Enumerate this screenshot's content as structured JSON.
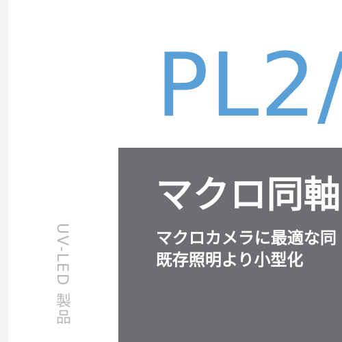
{
  "product": {
    "model": "PL2/",
    "category_vertical": "UV-LED 製品"
  },
  "feature": {
    "heading": "マクロ同軸",
    "desc_line_1": "マクロカメラに最適な同",
    "desc_line_2": "既存照明より小型化"
  },
  "colors": {
    "brand_blue": "#5aa0d6",
    "panel_gray": "#6d6e71",
    "muted_gray": "#b6b8bc",
    "strip": "#f3f4f6"
  }
}
